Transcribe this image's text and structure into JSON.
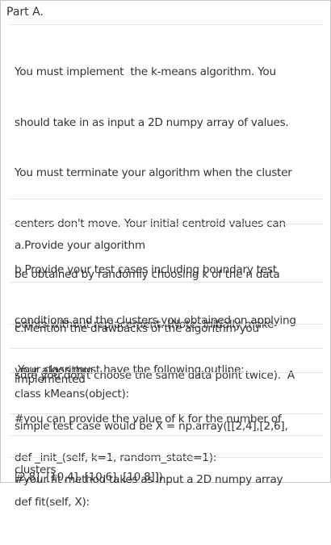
{
  "part_title": "Part A.",
  "intro_lines": [
    "You must implement  the k-means algorithm. You",
    "should take in as input a 2D numpy array of values.",
    "You must terminate your algorithm when the cluster",
    "centers don't move. Your initial centroid values can",
    "be obtained by randomly choosing k of the n data",
    "points without replacement. (Note: Initially make",
    "sure you don't choose the same data point twice).  A",
    "simple test case would be X = np.array([[2,4],[2,6],",
    "[2,8], [10,4], [10,6], [10,8]])"
  ],
  "item_a": "a.Provide your algorithm",
  "item_b_lines": [
    "b.Provide your test cases including boundary test",
    "conditions and the clusters you obtained on applying",
    "your algorithm"
  ],
  "item_c_lines": [
    "c.Mention the drawbacks of the algorithm you",
    "implemented"
  ],
  "outline_heading": " Your class must have the following outline:",
  "code_class_line": "class kMeans(object):",
  "code_comment_k_lines": [
    "#you can provide the value of k for the number of",
    "clusters"
  ],
  "code_init_line": "def _init_(self, k=1, random_state=1):",
  "code_comment_fit_line": "#your fit method takes as input a 2D numpy array",
  "code_fit_line": "def fit(self, X):"
}
